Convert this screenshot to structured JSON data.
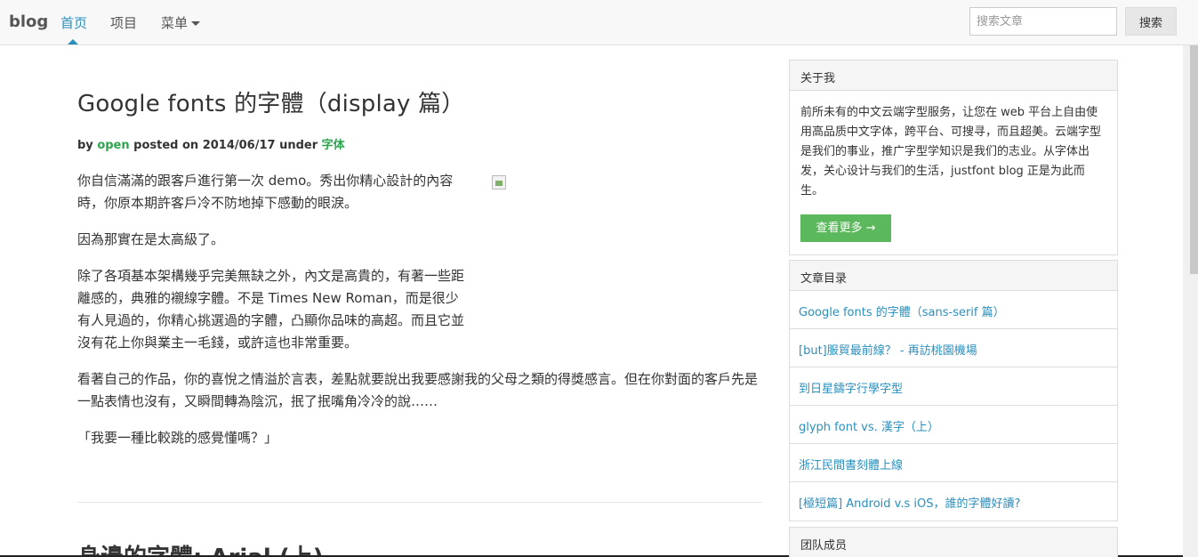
{
  "nav": {
    "brand": "blog",
    "items": [
      {
        "label": "首页",
        "active": true
      },
      {
        "label": "项目"
      },
      {
        "label": "菜单"
      }
    ],
    "search_placeholder": "搜索文章",
    "search_button": "搜索"
  },
  "post": {
    "title": "Google fonts 的字體（display 篇）",
    "meta_by": "by",
    "meta_author": "open",
    "meta_posted": "posted on 2014/06/17 under",
    "meta_category": "字体",
    "paragraphs": [
      "你自信滿滿的跟客戶進行第一次 demo。秀出你精心設計的內容時，你原本期許客戶冷不防地掉下感動的眼淚。",
      "因為那實在是太高級了。",
      "除了各項基本架構幾乎完美無缺之外，內文是高貴的，有著一些距離感的，典雅的襯線字體。不是 Times New Roman，而是很少有人見過的，你精心挑選過的字體，凸顯你品味的高超。而且它並沒有花上你與業主一毛錢，或許這也非常重要。",
      "看著自己的作品，你的喜悅之情溢於言表，差點就要說出我要感謝我的父母之類的得獎感言。但在你對面的客戶先是一點表情也沒有，又瞬間轉為陰沉，抿了抿嘴角冷冷的說……",
      "「我要一種比較跳的感覺懂嗎？」"
    ],
    "next_title": "身邊的字體: Arial (上)"
  },
  "sidebar": {
    "about_title": "关于我",
    "about_text": "前所未有的中文云端字型服务，让您在 web 平台上自由使用高品质中文字体，跨平台、可搜寻，而且超美。云端字型是我们的事业，推广字型学知识是我们的志业。从字体出发，关心设计与我们的生活，justfont blog 正是为此而生。",
    "about_button": "查看更多 →",
    "toc_title": "文章目录",
    "toc_items": [
      "Google fonts 的字體（sans-serif 篇）",
      "[but]服貿最前線？ - 再訪桃園機場",
      "到日星鑄字行學字型",
      "glyph font vs. 漢字（上）",
      "浙江民間書刻體上線",
      "[極短篇] Android v.s iOS，誰的字體好讀?"
    ],
    "team_title": "团队成员"
  }
}
